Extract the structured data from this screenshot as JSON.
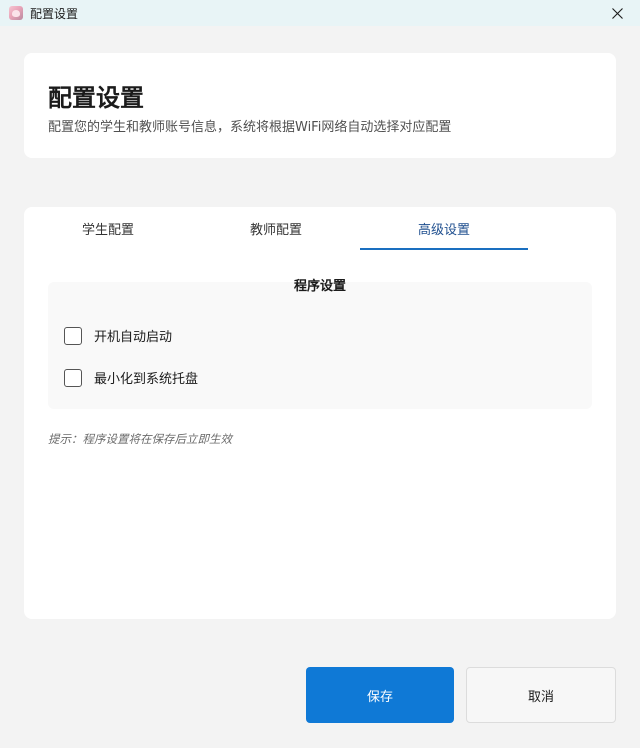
{
  "window": {
    "title": "配置设置",
    "app_icon": "app-avatar-icon",
    "close_icon": "close-icon"
  },
  "header": {
    "title": "配置设置",
    "subtitle": "配置您的学生和教师账号信息，系统将根据WiFi网络自动选择对应配置"
  },
  "tabs": [
    {
      "label": "学生配置",
      "active": false
    },
    {
      "label": "教师配置",
      "active": false
    },
    {
      "label": "高级设置",
      "active": true
    }
  ],
  "program_settings": {
    "title": "程序设置",
    "options": [
      {
        "label": "开机自动启动",
        "checked": false
      },
      {
        "label": "最小化到系统托盘",
        "checked": false
      }
    ]
  },
  "hint": "提示：程序设置将在保存后立即生效",
  "buttons": {
    "save": "保存",
    "cancel": "取消"
  },
  "colors": {
    "accent": "#0f79d6",
    "tab_indicator": "#1a6fc0",
    "titlebar": "#e8f4f6",
    "background": "#f3f3f3"
  }
}
